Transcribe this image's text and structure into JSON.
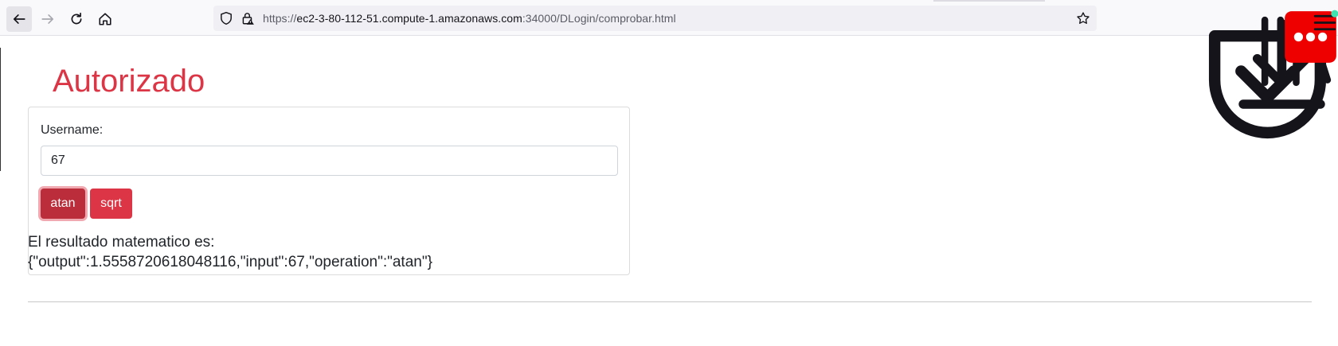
{
  "browser": {
    "url_prefix": "https://",
    "url_host": "ec2-3-80-112-51.compute-1.amazonaws.com",
    "url_rest": ":34000/DLogin/comprobar.html"
  },
  "page": {
    "title": "Autorizado",
    "username_label": "Username:",
    "username_value": "67",
    "buttons": {
      "atan": "atan",
      "sqrt": "sqrt"
    },
    "result_label": "El resultado matematico es:",
    "result_json": "{\"output\":1.5558720618048116,\"input\":67,\"operation\":\"atan\"}"
  },
  "colors": {
    "accent": "#dc3545",
    "accent_focus": "#bb2d3b"
  }
}
